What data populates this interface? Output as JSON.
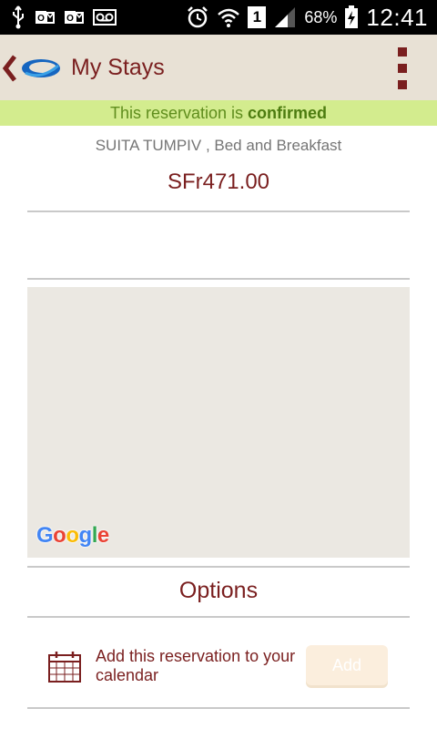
{
  "status_bar": {
    "icons": [
      "usb-icon",
      "outlook-icon",
      "outlook-icon",
      "voicemail-icon",
      "alarm-icon",
      "wifi-icon",
      "sim-icon",
      "signal-icon",
      "battery-charging-icon"
    ],
    "sim_slot": "1",
    "battery_percent": "68%",
    "time": "12:41"
  },
  "app_bar": {
    "title": "My Stays",
    "back_icon": "chevron-left-icon",
    "logo_icon": "app-logo-icon",
    "menu_icon": "overflow-menu-icon",
    "background": "#e8e1d5",
    "accent": "#7a1f1f"
  },
  "banner": {
    "prefix": "This reservation is ",
    "status": "confirmed",
    "background": "#d3ec8e"
  },
  "reservation": {
    "hotel": "SUITA TUMPIV , Bed and Breakfast",
    "price": "SFr471.00"
  },
  "map": {
    "attribution_letters": [
      "G",
      "o",
      "o",
      "g",
      "l",
      "e"
    ]
  },
  "options": {
    "title": "Options",
    "calendar_label": "Add this reservation to your calendar",
    "calendar_icon": "calendar-icon",
    "add_button": "Add"
  }
}
